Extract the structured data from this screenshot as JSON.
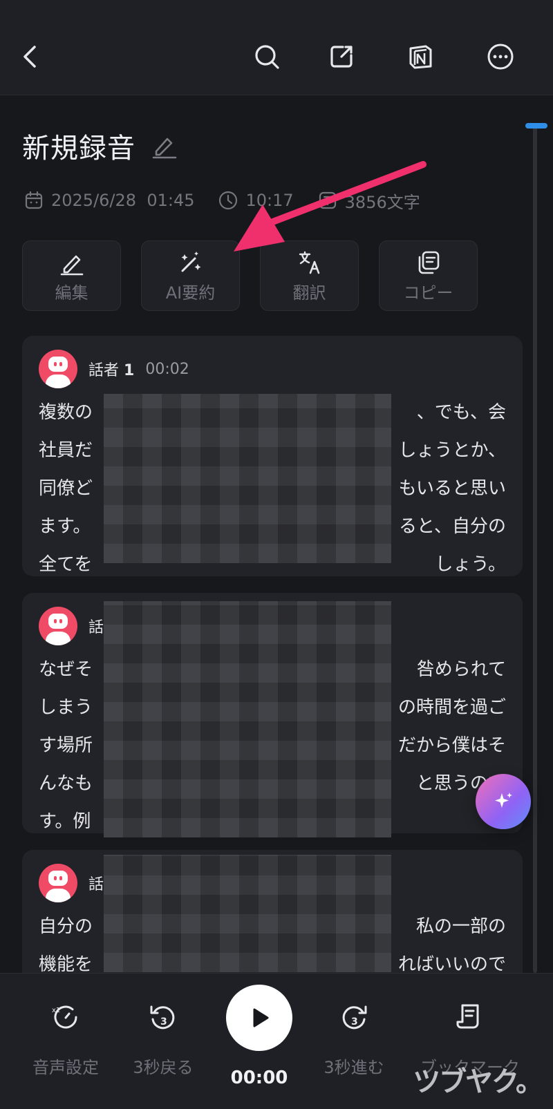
{
  "title": "新規録音",
  "meta": {
    "date": "2025/6/28  01:45",
    "duration": "10:17",
    "chars": "3856文字"
  },
  "actions": [
    "編集",
    "AI要約",
    "翻訳",
    "コピー"
  ],
  "cards": [
    {
      "speaker_label": "話者",
      "speaker_num": "1",
      "time": "00:02",
      "lines": [
        "複数の",
        "社員だ",
        "同僚ど",
        "ます。",
        "全てを"
      ],
      "lines_right": [
        "、でも、会",
        "しょうとか、",
        "もいると思い",
        "ると、自分の",
        "しょう。"
      ]
    },
    {
      "speaker_label": "話",
      "lines": [
        "なぜそ",
        "しまう",
        "す場所",
        "んなも",
        "す。例"
      ],
      "lines_right": [
        "咎められて",
        "の時間を過ご",
        "だから僕はそ",
        "と思うので",
        ""
      ]
    },
    {
      "speaker_label": "話",
      "lines": [
        "自分の",
        "機能を"
      ],
      "lines_right": [
        "私の一部の",
        "ればいいので"
      ]
    }
  ],
  "bottom": {
    "audio_settings": "音声設定",
    "back": "3秒戻る",
    "play_time": "00:00",
    "forward": "3秒進む",
    "bookmark": "ブックマーク",
    "speed_badge": "x1",
    "skip_badge": "3"
  },
  "watermark": "ツブヤク。",
  "colors": {
    "accent_blue": "#2f8fe8",
    "avatar_pink": "#ef4a66",
    "arrow_pink": "#f0306d"
  }
}
